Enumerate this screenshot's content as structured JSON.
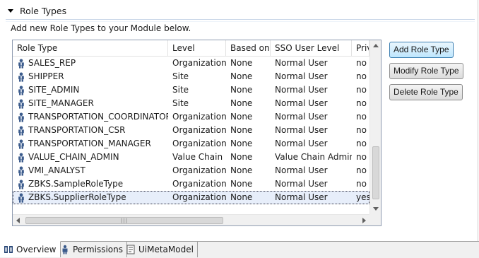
{
  "section": {
    "title": "Role Types",
    "description": "Add new Role Types to your Module below."
  },
  "table": {
    "columns": [
      "Role Type",
      "Level",
      "Based on",
      "SSO User Level",
      "Priv"
    ],
    "rows": [
      {
        "role": "SALES_REP",
        "level": "Organization",
        "based": "None",
        "sso": "Normal User",
        "priv": "no"
      },
      {
        "role": "SHIPPER",
        "level": "Site",
        "based": "None",
        "sso": "Normal User",
        "priv": "no"
      },
      {
        "role": "SITE_ADMIN",
        "level": "Site",
        "based": "None",
        "sso": "Normal User",
        "priv": "no"
      },
      {
        "role": "SITE_MANAGER",
        "level": "Site",
        "based": "None",
        "sso": "Normal User",
        "priv": "no"
      },
      {
        "role": "TRANSPORTATION_COORDINATOR",
        "level": "Organization",
        "based": "None",
        "sso": "Normal User",
        "priv": "no"
      },
      {
        "role": "TRANSPORTATION_CSR",
        "level": "Organization",
        "based": "None",
        "sso": "Normal User",
        "priv": "no"
      },
      {
        "role": "TRANSPORTATION_MANAGER",
        "level": "Organization",
        "based": "None",
        "sso": "Normal User",
        "priv": "no"
      },
      {
        "role": "VALUE_CHAIN_ADMIN",
        "level": "Value Chain",
        "based": "None",
        "sso": "Value Chain Admin",
        "priv": "no"
      },
      {
        "role": "VMI_ANALYST",
        "level": "Organization",
        "based": "None",
        "sso": "Normal User",
        "priv": "no"
      },
      {
        "role": "ZBKS.SampleRoleType",
        "level": "Organization",
        "based": "None",
        "sso": "Normal User",
        "priv": "no"
      },
      {
        "role": "ZBKS.SupplierRoleType",
        "level": "Organization",
        "based": "None",
        "sso": "Normal User",
        "priv": "yes",
        "selected": true
      }
    ]
  },
  "buttons": {
    "add": "Add Role Type",
    "modify": "Modify Role Type",
    "delete": "Delete Role Type"
  },
  "tabs": [
    {
      "label": "Overview",
      "icon": "overview-icon",
      "active": true
    },
    {
      "label": "Permissions",
      "icon": "person-icon",
      "active": false
    },
    {
      "label": "UiMetaModel",
      "icon": "document-icon",
      "active": false
    }
  ],
  "colors": {
    "selected_row": "#e7eefa",
    "focused_button": "#bee6fd"
  }
}
